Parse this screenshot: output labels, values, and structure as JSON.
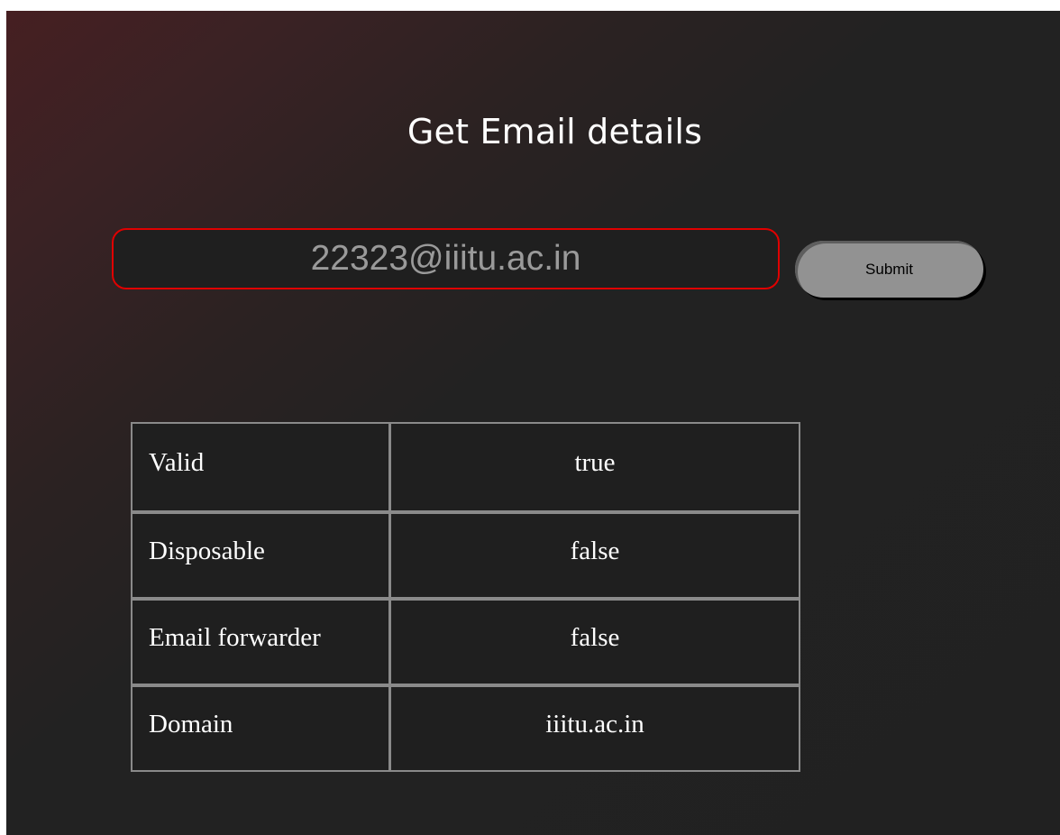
{
  "header": {
    "title": "Get Email details"
  },
  "form": {
    "email_value": "22323@iiitu.ac.in",
    "submit_label": "Submit"
  },
  "results": {
    "rows": [
      {
        "label": "Valid",
        "value": "true"
      },
      {
        "label": "Disposable",
        "value": "false"
      },
      {
        "label": "Email forwarder",
        "value": "false"
      },
      {
        "label": "Domain",
        "value": "iiitu.ac.in"
      }
    ]
  },
  "colors": {
    "input_border": "#e00000",
    "button_bg": "#929292",
    "page_bg": "#212121",
    "gradient_accent": "#461f22"
  }
}
